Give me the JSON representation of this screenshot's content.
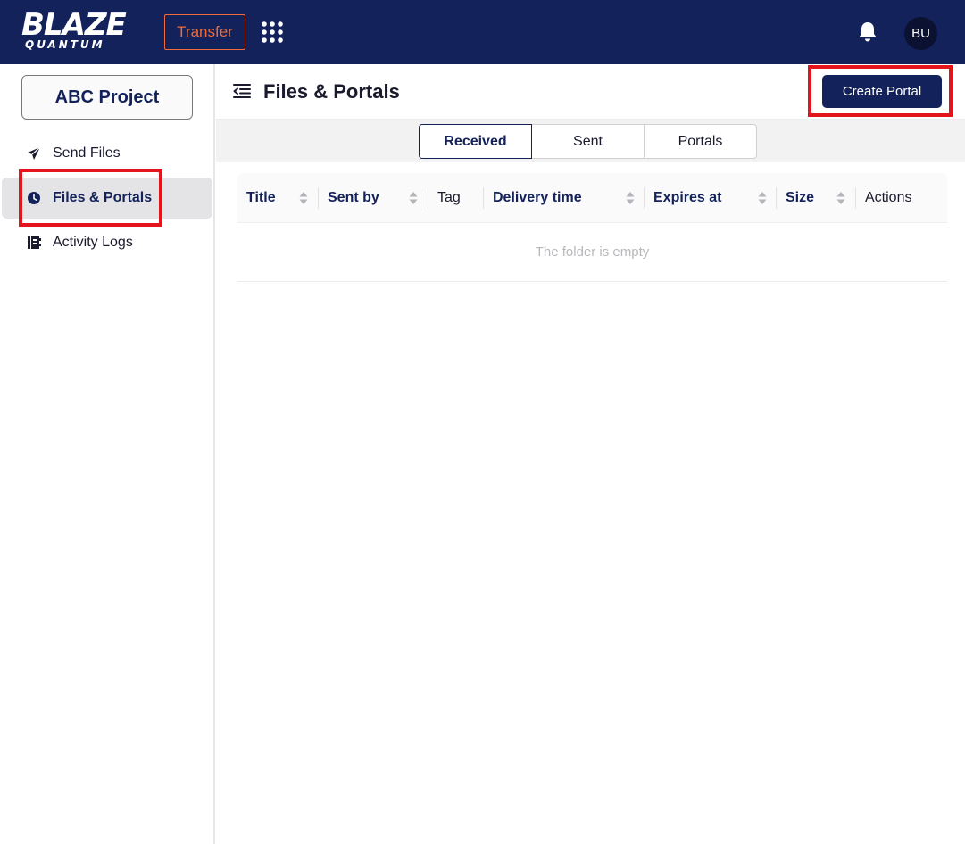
{
  "header": {
    "logo_line1": "BLAZE",
    "logo_line2": "QUANTUM",
    "app_button": "Transfer",
    "apps_icon": "grid-dots-icon",
    "notification_icon": "bell-icon",
    "avatar_initials": "BU",
    "colors": {
      "background": "#13225a",
      "accent": "#f26b3a"
    }
  },
  "sidebar": {
    "project_button": "ABC Project",
    "items": [
      {
        "label": "Send Files",
        "icon": "paper-plane-icon"
      },
      {
        "label": "Files & Portals",
        "icon": "clock-icon",
        "active": true
      },
      {
        "label": "Activity Logs",
        "icon": "log-book-icon"
      }
    ]
  },
  "main": {
    "title": "Files & Portals",
    "collapse_icon": "menu-collapse-icon",
    "create_button": "Create Portal",
    "tabs": [
      {
        "label": "Received",
        "active": true
      },
      {
        "label": "Sent"
      },
      {
        "label": "Portals"
      }
    ],
    "table": {
      "columns": [
        {
          "label": "Title",
          "sortable": true
        },
        {
          "label": "Sent by",
          "sortable": true
        },
        {
          "label": "Tag",
          "sortable": false
        },
        {
          "label": "Delivery time",
          "sortable": true
        },
        {
          "label": "Expires at",
          "sortable": true
        },
        {
          "label": "Size",
          "sortable": true
        },
        {
          "label": "Actions",
          "sortable": false
        }
      ],
      "empty_text": "The folder is empty"
    }
  }
}
